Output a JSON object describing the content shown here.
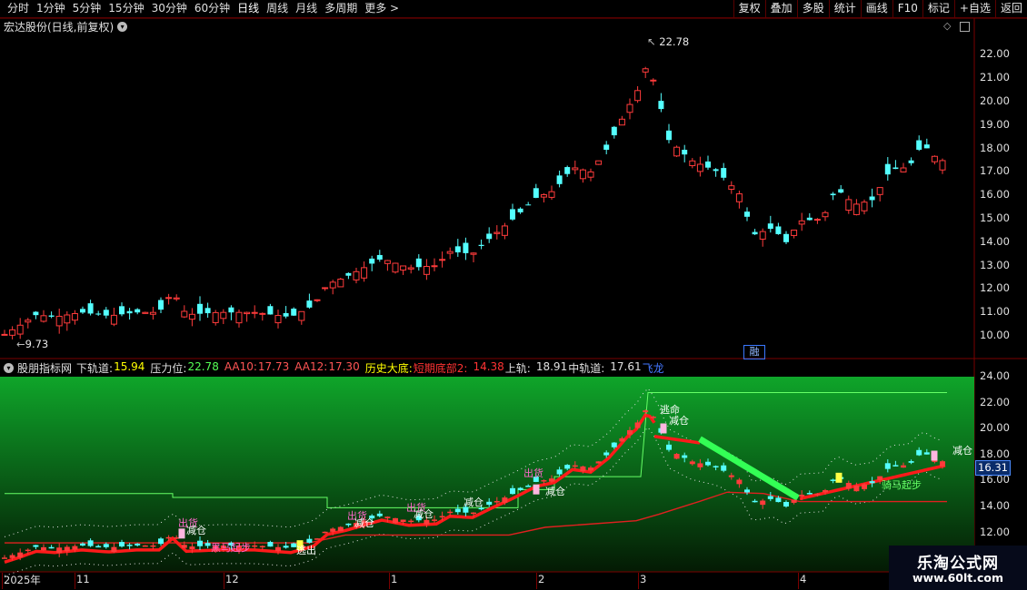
{
  "toolbar": {
    "periods": [
      "分时",
      "1分钟",
      "5分钟",
      "15分钟",
      "30分钟",
      "60分钟",
      "日线",
      "周线",
      "月线",
      "多周期",
      "更多 >"
    ],
    "active_period": "日线",
    "right_buttons": [
      "复权",
      "叠加",
      "多股",
      "统计",
      "画线",
      "F10",
      "标记",
      "+自选",
      "返回"
    ]
  },
  "main_chart": {
    "title": "宏达股份(日线,前复权)",
    "high_label": "22.78",
    "low_label": "9.73",
    "y_ticks": [
      "22.00",
      "21.00",
      "20.00",
      "19.00",
      "18.00",
      "17.00",
      "16.00",
      "15.00",
      "14.00",
      "13.00",
      "12.00",
      "11.00",
      "10.00"
    ],
    "badge": "融"
  },
  "indicator": {
    "name": "股朋指标网",
    "items": [
      {
        "text": "下轨道:",
        "color": "#e0e0e0"
      },
      {
        "text": "15.94",
        "color": "#ffff00"
      },
      {
        "text": "压力位:",
        "color": "#e0e0e0"
      },
      {
        "text": "22.78",
        "color": "#55ff55"
      },
      {
        "text": "AA10:",
        "color": "#ff5555"
      },
      {
        "text": "17.73",
        "color": "#ff5555"
      },
      {
        "text": "AA12:",
        "color": "#ff5555"
      },
      {
        "text": "17.30",
        "color": "#ff5555"
      },
      {
        "text": "历史大底:",
        "color": "#ffff00"
      },
      {
        "text": "短期底部2:",
        "color": "#ff3333"
      },
      {
        "text": "14.38",
        "color": "#ff3333"
      },
      {
        "text": "上轨:",
        "color": "#e0e0e0"
      },
      {
        "text": "18.91",
        "color": "#e0e0e0"
      },
      {
        "text": "中轨道:",
        "color": "#e0e0e0"
      },
      {
        "text": "17.61",
        "color": "#e0e0e0"
      },
      {
        "text": "飞龙",
        "color": "#4477ff"
      }
    ],
    "y_ticks": [
      "24.00",
      "22.00",
      "20.00",
      "18.00",
      "16.00",
      "14.00",
      "12.00"
    ],
    "current_price": "16.31",
    "signals": [
      "出货",
      "减仓",
      "出货",
      "减仓",
      "出货",
      "减仓",
      "减仓",
      "出货",
      "减仓",
      "逃命",
      "减仓",
      "减仓",
      "逃出",
      "黑马起步",
      "骑马起步"
    ]
  },
  "x_axis": {
    "labels": [
      "2025年",
      "11",
      "12",
      "1",
      "2",
      "3",
      "4"
    ]
  },
  "watermark": {
    "line1": "乐淘公式网",
    "line2": "www.60lt.com"
  }
}
